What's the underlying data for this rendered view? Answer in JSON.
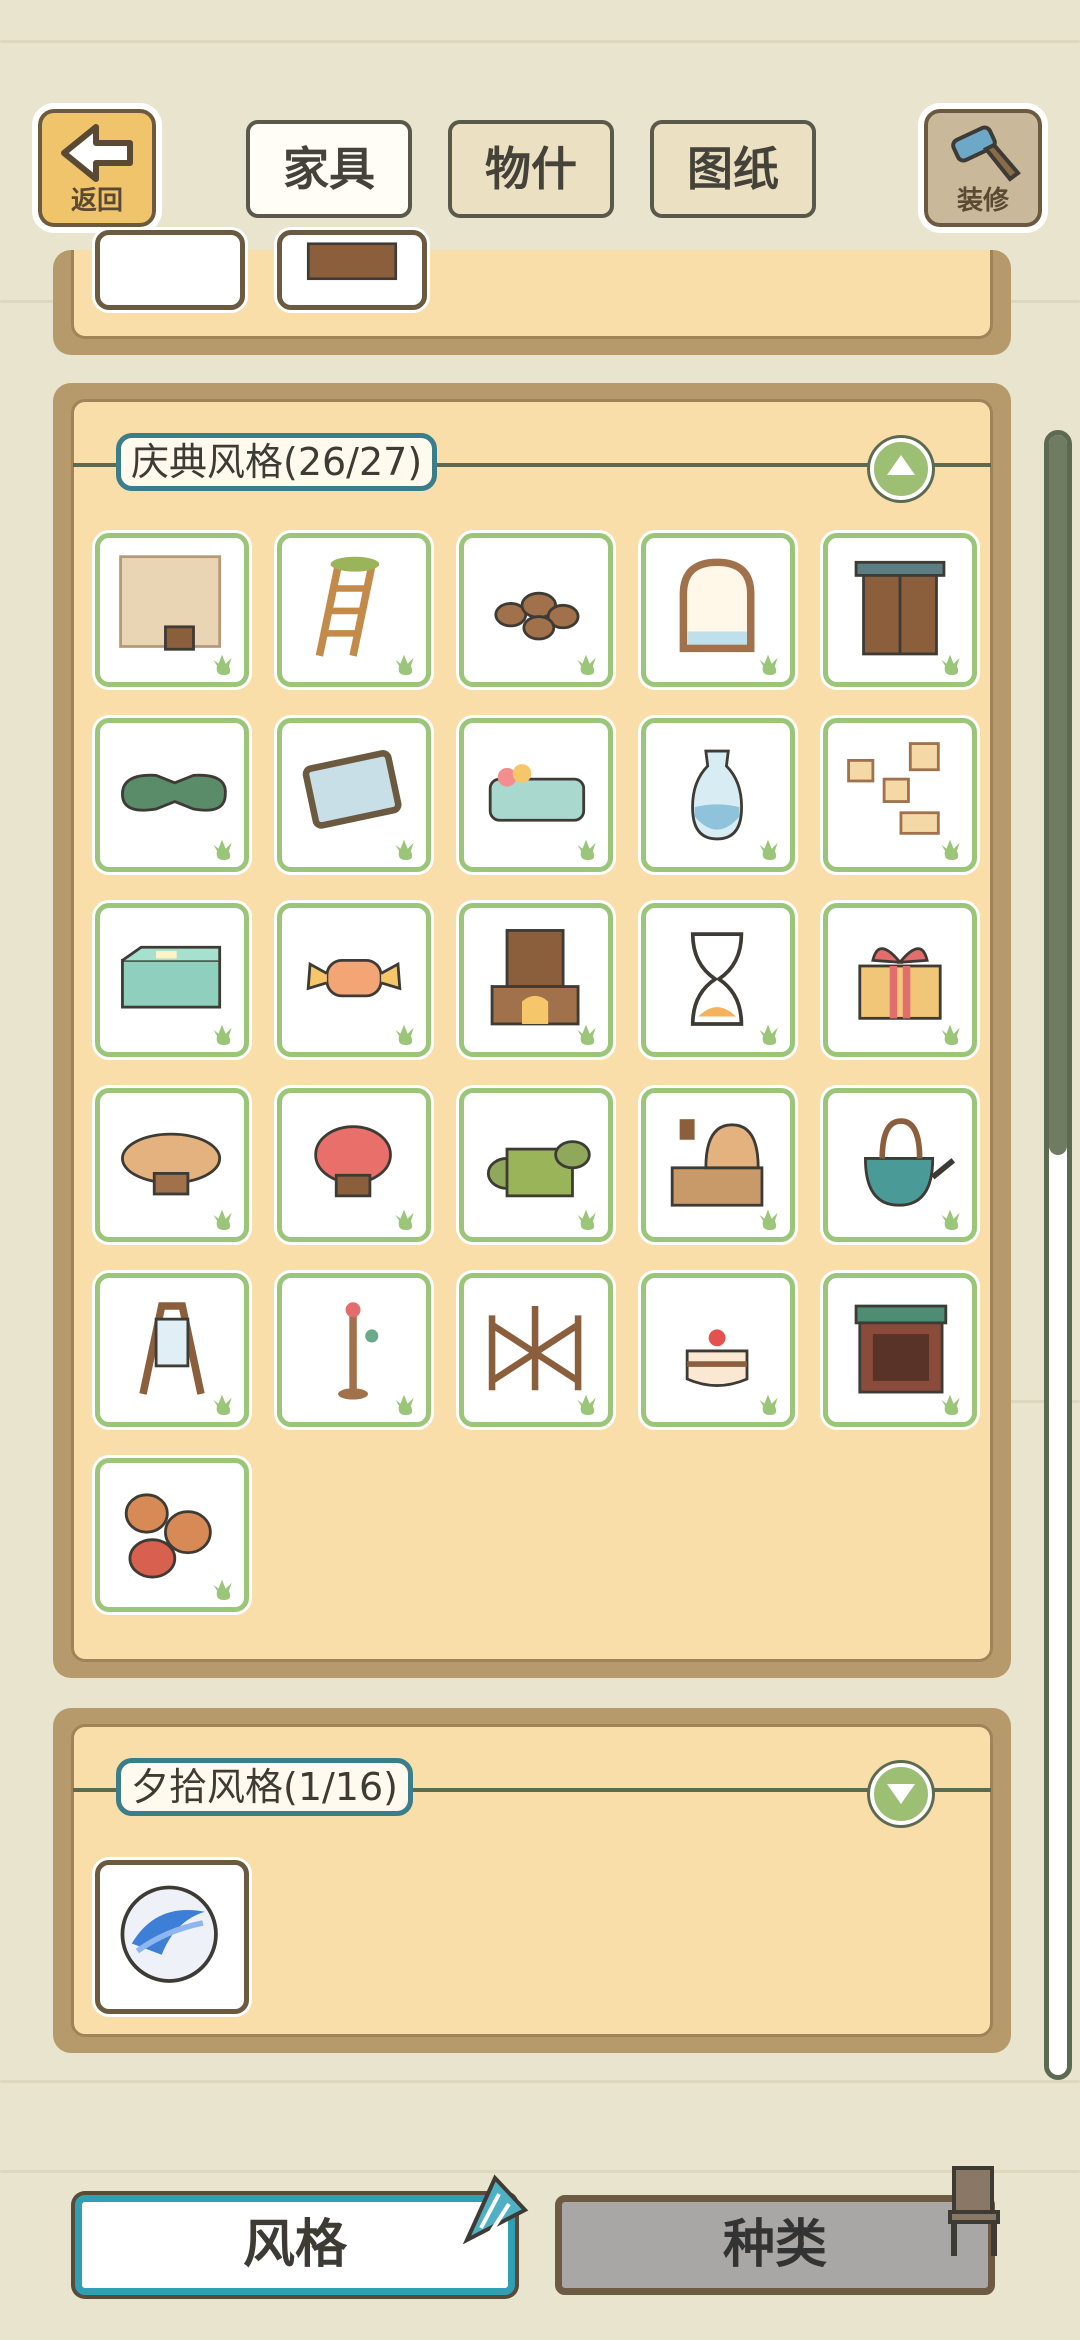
{
  "topbar": {
    "back_label": "返回",
    "decorate_label": "装修",
    "tabs": [
      {
        "label": "家具",
        "active": true
      },
      {
        "label": "物什",
        "active": false
      },
      {
        "label": "图纸",
        "active": false
      }
    ]
  },
  "sections": [
    {
      "title": "庆典风格(26/27)",
      "expanded": true,
      "items": [
        {
          "name": "wooden-wall-with-bucket"
        },
        {
          "name": "grass-ladder"
        },
        {
          "name": "clay-pots"
        },
        {
          "name": "arched-window"
        },
        {
          "name": "wooden-door"
        },
        {
          "name": "green-sleeping-bag"
        },
        {
          "name": "framed-mirror-picture"
        },
        {
          "name": "flower-bed"
        },
        {
          "name": "glass-vase"
        },
        {
          "name": "memo-board"
        },
        {
          "name": "green-box"
        },
        {
          "name": "striped-candy"
        },
        {
          "name": "fireplace-cabinet"
        },
        {
          "name": "hourglass"
        },
        {
          "name": "gift-box"
        },
        {
          "name": "mushroom-stool-tan"
        },
        {
          "name": "mushroom-stool-red"
        },
        {
          "name": "rolled-mats"
        },
        {
          "name": "stove-counter"
        },
        {
          "name": "watering-kettle"
        },
        {
          "name": "easel-mirror"
        },
        {
          "name": "coat-stand"
        },
        {
          "name": "wooden-fence"
        },
        {
          "name": "cherry-cake"
        },
        {
          "name": "green-top-cabinet"
        },
        {
          "name": "sacks-of-goods"
        }
      ]
    },
    {
      "title": "夕拾风格(1/16)",
      "expanded": false,
      "items": [
        {
          "name": "blue-swirl-marble"
        }
      ]
    }
  ],
  "bottom": {
    "style_label": "风格",
    "kind_label": "种类"
  },
  "colors": {
    "background": "#e8e4cd",
    "panel": "#f9dea9",
    "item_border": "#9bc67a",
    "accent": "#2f9fb3"
  }
}
